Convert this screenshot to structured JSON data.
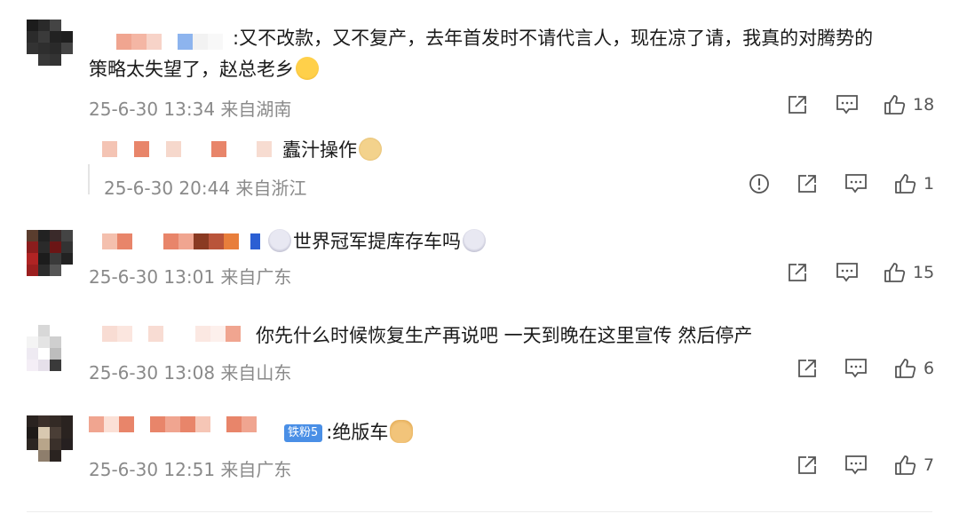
{
  "comments": [
    {
      "text_line1": ":又不改款，又不复产，去年首发时不请代言人，现在凉了请，我真的对腾势的",
      "text_line2": "策略太失望了，赵总老乡",
      "time": "25-6-30 13:34",
      "location": "来自湖南",
      "like_count": "18"
    },
    {
      "text": "蠹汁操作",
      "time": "25-6-30 20:44",
      "location": "来自浙江",
      "like_count": "1"
    },
    {
      "text": "世界冠军提库存车吗",
      "time": "25-6-30 13:01",
      "location": "来自广东",
      "like_count": "15"
    },
    {
      "text": "你先什么时候恢复生产再说吧 一天到晚在这里宣传 然后停产",
      "time": "25-6-30 13:08",
      "location": "来自山东",
      "like_count": "6"
    },
    {
      "badge": "铁粉5",
      "text": ":绝版车",
      "time": "25-6-30 12:51",
      "location": "来自广东",
      "like_count": "7"
    }
  ],
  "colors": {
    "meta": "#8a8a8a",
    "text": "#1a1a1a",
    "badge": "#4a8fe6",
    "blur_orange": "#e8856a"
  },
  "icons": [
    "share-icon",
    "comment-icon",
    "like-icon",
    "report-icon"
  ]
}
